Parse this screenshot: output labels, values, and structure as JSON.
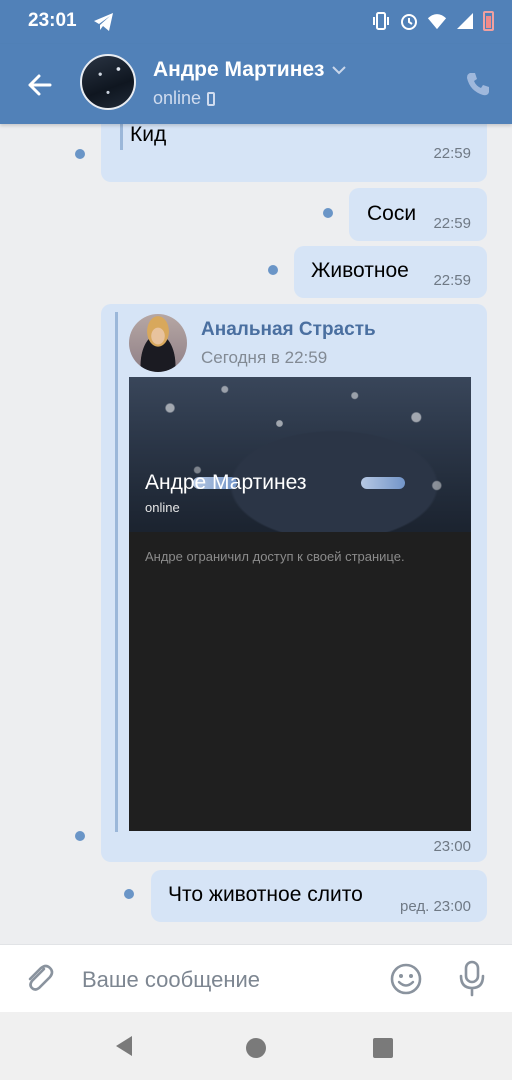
{
  "status_bar": {
    "time": "23:01"
  },
  "header": {
    "name": "Андре Мартинез",
    "status": "online"
  },
  "messages": [
    {
      "text": "Кид",
      "time": "22:59"
    },
    {
      "text": "Соси",
      "time": "22:59"
    },
    {
      "text": "Животное",
      "time": "22:59"
    }
  ],
  "forwarded": {
    "author": "Анальная Страсть",
    "date": "Сегодня в 22:59",
    "card_name": "Андре Мартинез",
    "card_status": "online",
    "card_text": "Андре ограничил доступ к своей странице.",
    "time": "23:00"
  },
  "last_message": {
    "text": "Что животное слито",
    "time": "ред. 23:00"
  },
  "composer": {
    "placeholder": "Ваше сообщение"
  },
  "colors": {
    "header": "#5181b8",
    "bubble": "#d6e4f6",
    "background": "#edeef0"
  }
}
